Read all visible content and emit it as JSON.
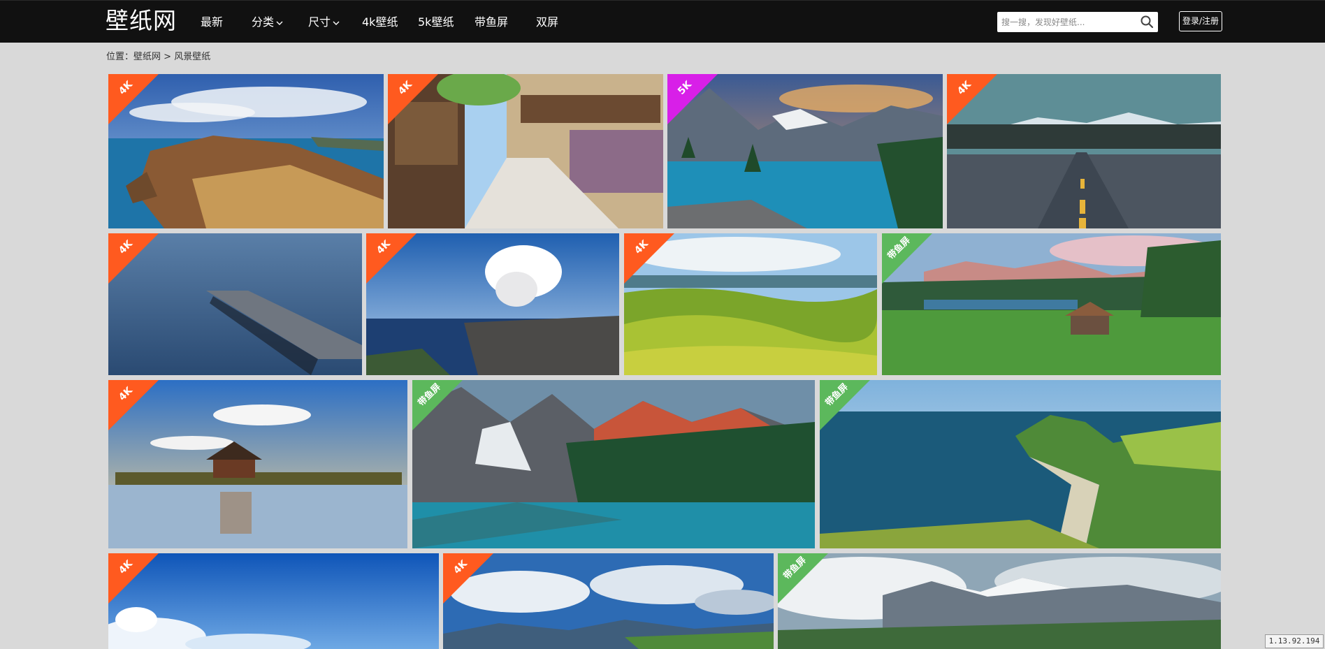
{
  "header": {
    "logo": "壁纸网",
    "nav": [
      {
        "label": "最新"
      },
      {
        "label": "分类",
        "dropdown": true
      },
      {
        "label": "尺寸",
        "dropdown": true
      },
      {
        "label": "4k壁纸"
      },
      {
        "label": "5k壁纸"
      },
      {
        "label": "带鱼屏"
      },
      {
        "label": "双屏"
      }
    ],
    "search_placeholder": "搜一搜，发现好壁纸...",
    "login_label": "登录/注册"
  },
  "breadcrumb": {
    "prefix": "位置：",
    "home": "壁纸网",
    "separator": " > ",
    "current": "风景壁纸"
  },
  "colors": {
    "badge_4k": "#ff5a1f",
    "badge_5k": "#d81fe8",
    "badge_ultrawide": "#5cb85c"
  },
  "wallpapers": [
    {
      "badge": "4K",
      "scene": "coastal-cliffs"
    },
    {
      "badge": "4K",
      "scene": "anime-street"
    },
    {
      "badge": "5K",
      "scene": "mountain-lake-sunset"
    },
    {
      "badge": "4K",
      "scene": "open-road"
    },
    {
      "badge": "4K",
      "scene": "misty-pier"
    },
    {
      "badge": "4K",
      "scene": "volcano-coast"
    },
    {
      "badge": "4K",
      "scene": "green-hills"
    },
    {
      "badge": "带鱼屏",
      "scene": "alpine-meadow-cabin"
    },
    {
      "badge": "4K",
      "scene": "palace-reflection"
    },
    {
      "badge": "带鱼屏",
      "scene": "red-peaks-lake"
    },
    {
      "badge": "带鱼屏",
      "scene": "sea-cliff-bay"
    },
    {
      "badge": "4K",
      "scene": "blue-sky-clouds"
    },
    {
      "badge": "4K",
      "scene": "cloud-valley"
    },
    {
      "badge": "带鱼屏",
      "scene": "snowy-mountains-clouds"
    }
  ],
  "ip": "1.13.92.194"
}
